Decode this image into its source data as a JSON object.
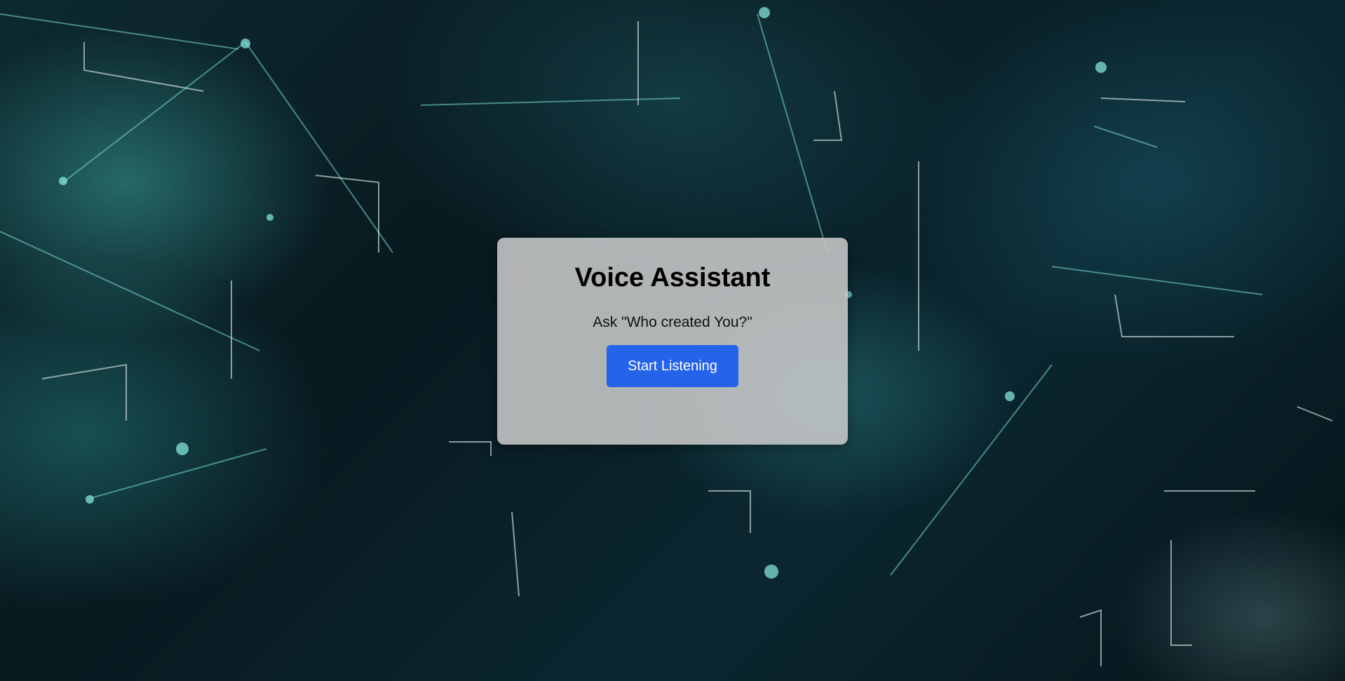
{
  "assistant": {
    "title": "Voice Assistant",
    "prompt": "Ask \"Who created You?\"",
    "start_button_label": "Start Listening"
  },
  "colors": {
    "button": "#2563eb",
    "card": "#cdcdcd",
    "background_dark": "#08191f",
    "accent_teal": "#46beb4"
  }
}
